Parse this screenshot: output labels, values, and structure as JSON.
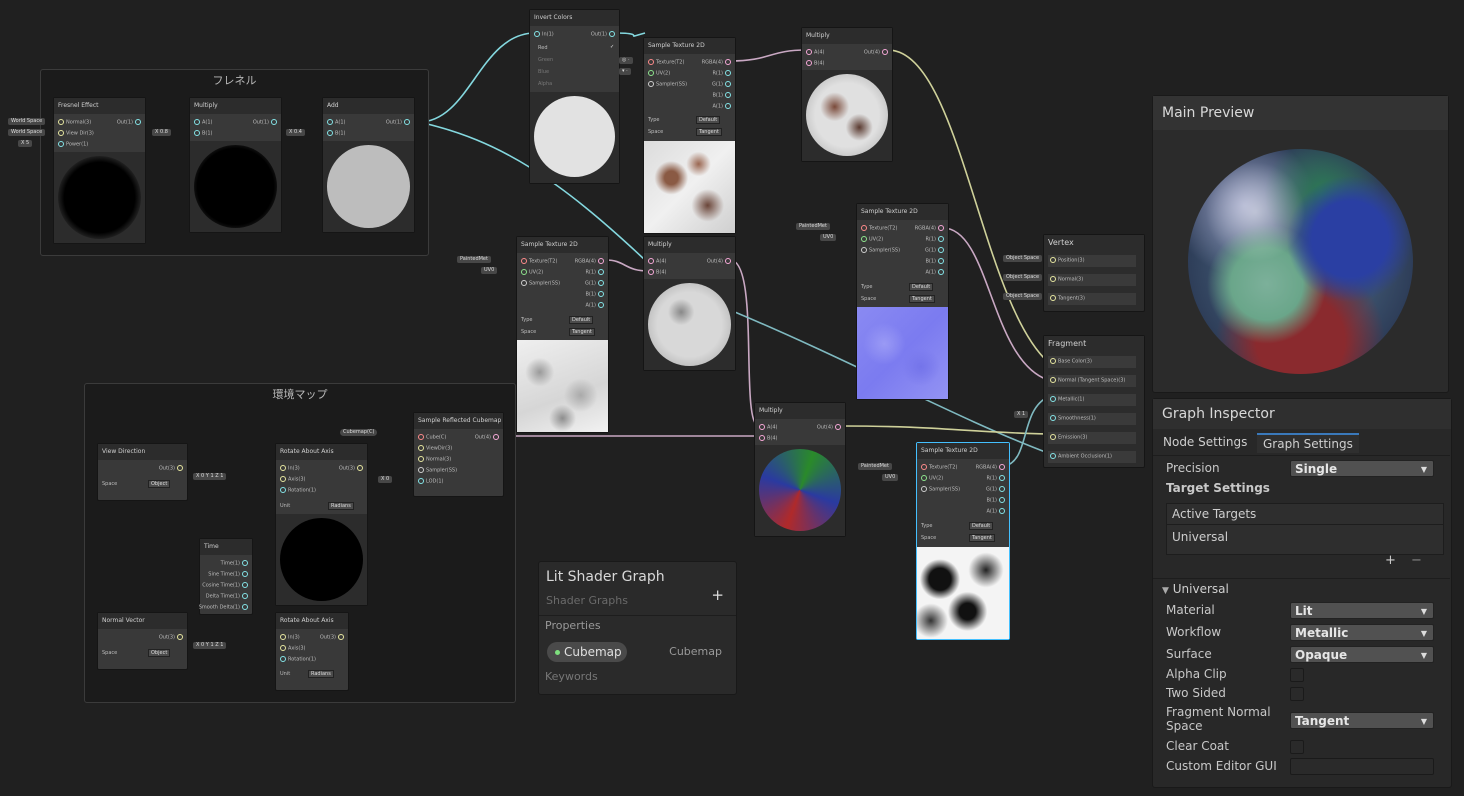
{
  "groups": {
    "fresnel_title": "フレネル",
    "envmap_title": "環境マップ"
  },
  "nodes": {
    "fresnel": {
      "title": "Fresnel Effect",
      "in1": "Normal(3)",
      "in2": "View Dir(3)",
      "in3": "Power(1)",
      "out": "Out(1)",
      "ws1": "World Space",
      "ws2": "World Space",
      "xlab": "X",
      "xval": "5"
    },
    "multiply1": {
      "title": "Multiply",
      "a": "A(1)",
      "b": "B(1)",
      "out": "Out(1)",
      "xlab": "X",
      "xval": "0.8"
    },
    "add": {
      "title": "Add",
      "a": "A(1)",
      "b": "B(1)",
      "out": "Out(1)",
      "xlab": "X",
      "xval": "0.4"
    },
    "invert": {
      "title": "Invert Colors",
      "in": "In(1)",
      "out": "Out(1)",
      "red": "Red",
      "green": "Green",
      "blue": "Blue",
      "alpha": "Alpha",
      "check": "✓"
    },
    "sample3d": {
      "title": "Sample Texture 2D",
      "in1": "Texture(T2)",
      "in2": "UV(2)",
      "in3": "Sampler(SS)",
      "o1": "RGBA(4)",
      "o2": "R(1)",
      "o3": "G(1)",
      "o4": "B(1)",
      "o5": "A(1)",
      "type_lab": "Type",
      "type_val": "Default",
      "space_lab": "Space",
      "space_val": "Tangent"
    },
    "multiply_top": {
      "title": "Multiply",
      "a": "A(4)",
      "b": "B(4)",
      "out": "Out(4)"
    },
    "sample_mid": {
      "title": "Sample Texture 2D",
      "in1": "Texture(T2)",
      "in2": "UV(2)",
      "in3": "Sampler(SS)",
      "o1": "RGBA(4)",
      "o2": "R(1)",
      "o3": "G(1)",
      "o4": "B(1)",
      "o5": "A(1)",
      "type_lab": "Type",
      "type_val": "Default",
      "space_lab": "Space",
      "space_val": "Tangent",
      "tex_lab": "PaintedMet",
      "uv_lab": "UV0"
    },
    "multiply_mid": {
      "title": "Multiply",
      "a": "A(4)",
      "b": "B(4)",
      "out": "Out(4)"
    },
    "sample_normal": {
      "title": "Sample Texture 2D",
      "in1": "Texture(T2)",
      "in2": "UV(2)",
      "in3": "Sampler(SS)",
      "o1": "RGBA(4)",
      "o2": "R(1)",
      "o3": "G(1)",
      "o4": "B(1)",
      "o5": "A(1)",
      "type_lab": "Type",
      "type_val": "Default",
      "space_lab": "Space",
      "space_val": "Tangent",
      "tex_lab": "PaintedMet",
      "uv_lab": "UV0"
    },
    "multiply_bottom": {
      "title": "Multiply",
      "a": "A(4)",
      "b": "B(4)",
      "out": "Out(4)"
    },
    "sample_sel": {
      "title": "Sample Texture 2D",
      "in1": "Texture(T2)",
      "in2": "UV(2)",
      "in3": "Sampler(SS)",
      "o1": "RGBA(4)",
      "o2": "R(1)",
      "o3": "G(1)",
      "o4": "B(1)",
      "o5": "A(1)",
      "type_lab": "Type",
      "type_val": "Default",
      "space_lab": "Space",
      "space_val": "Tangent",
      "tex_lab": "PaintedMet",
      "uv_lab": "UV0"
    },
    "view_dir": {
      "title": "View Direction",
      "out": "Out(3)",
      "space_lab": "Space",
      "space_val": "Object"
    },
    "rotate1": {
      "title": "Rotate About Axis",
      "in": "In(3)",
      "axis": "Axis(3)",
      "rot": "Rotation(1)",
      "out": "Out(3)",
      "unit_lab": "Unit",
      "unit_val": "Radians",
      "x": "0",
      "y": "1",
      "z": "1"
    },
    "time": {
      "title": "Time",
      "o1": "Time(1)",
      "o2": "Sine Time(1)",
      "o3": "Cosine Time(1)",
      "o4": "Delta Time(1)",
      "o5": "Smooth Delta(1)"
    },
    "normal_vec": {
      "title": "Normal Vector",
      "out": "Out(3)",
      "space_lab": "Space",
      "space_val": "Object"
    },
    "rotate2": {
      "title": "Rotate About Axis",
      "in": "In(3)",
      "axis": "Axis(3)",
      "rot": "Rotation(1)",
      "out": "Out(3)",
      "unit_lab": "Unit",
      "unit_val": "Radians",
      "x": "0",
      "y": "1",
      "z": "1"
    },
    "refl": {
      "title": "Sample Reflected Cubemap",
      "i1": "Cube(C)",
      "i2": "ViewDir(3)",
      "i3": "Normal(3)",
      "i4": "Sampler(SS)",
      "i5": "LOD(1)",
      "out": "Out(4)",
      "cubemap_lab": "Cubemap(C)",
      "x": "0"
    },
    "vertex": {
      "title": "Vertex",
      "p1": "Position(3)",
      "p2": "Normal(3)",
      "p3": "Tangent(3)",
      "os": "Object Space"
    },
    "fragment": {
      "title": "Fragment",
      "p1": "Base Color(3)",
      "p2": "Normal (Tangent Space)(3)",
      "p3": "Metallic(1)",
      "p4": "Smoothness(1)",
      "p5": "Emission(3)",
      "p6": "Ambient Occlusion(1)",
      "x": "1"
    }
  },
  "blackboard": {
    "title": "Lit Shader Graph",
    "subtitle": "Shader Graphs",
    "add": "+",
    "properties": "Properties",
    "cubemap_prop": "Cubemap",
    "cubemap_type": "Cubemap",
    "keywords": "Keywords"
  },
  "main_preview": {
    "title": "Main Preview"
  },
  "inspector": {
    "title": "Graph Inspector",
    "tab_node": "Node Settings",
    "tab_graph": "Graph Settings",
    "precision_lab": "Precision",
    "precision_val": "Single",
    "target_settings": "Target Settings",
    "active_targets": "Active Targets",
    "universal_item": "Universal",
    "plus": "+",
    "minus": "−",
    "universal_section": "Universal",
    "material_lab": "Material",
    "material_val": "Lit",
    "workflow_lab": "Workflow",
    "workflow_val": "Metallic",
    "surface_lab": "Surface",
    "surface_val": "Opaque",
    "alpha_clip": "Alpha Clip",
    "two_sided": "Two Sided",
    "frag_normal": "Fragment Normal Space",
    "frag_normal_val": "Tangent",
    "clear_coat": "Clear Coat",
    "custom_gui": "Custom Editor GUI"
  },
  "colors": {
    "accent": "#3a79bb",
    "selection": "#44c0ff",
    "wire_float": "#cfd19a",
    "wire_vec4": "#c9a8c3",
    "wire_vec3": "#7fb9c0"
  }
}
